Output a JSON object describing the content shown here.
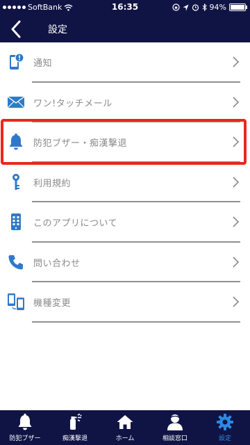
{
  "status_bar": {
    "carrier": "SoftBank",
    "time": "16:35",
    "battery": "94%"
  },
  "header": {
    "title": "設定"
  },
  "menu": {
    "items": [
      {
        "label": "通知",
        "icon": "phone-notification-icon"
      },
      {
        "label": "ワン!タッチメール",
        "icon": "envelope-icon"
      },
      {
        "label": "防犯ブザー・痴漢撃退",
        "icon": "bell-icon"
      },
      {
        "label": "利用規約",
        "icon": "key-icon"
      },
      {
        "label": "このアプリについて",
        "icon": "mobile-app-icon"
      },
      {
        "label": "問い合わせ",
        "icon": "phone-handset-icon"
      },
      {
        "label": "機種変更",
        "icon": "device-transfer-icon"
      }
    ]
  },
  "tabbar": {
    "tabs": [
      {
        "label": "防犯ブザー",
        "icon": "bell-icon"
      },
      {
        "label": "痴漢撃退",
        "icon": "spray-icon"
      },
      {
        "label": "ホーム",
        "icon": "home-icon"
      },
      {
        "label": "相談窓口",
        "icon": "person-icon"
      },
      {
        "label": "設定",
        "icon": "gear-icon"
      }
    ],
    "active_index": 4
  },
  "colors": {
    "header_bg": "#101445",
    "accent": "#2d8ae0",
    "icon": "#2f7ac8",
    "highlight": "#e8281d",
    "label": "#8a8a8a"
  }
}
